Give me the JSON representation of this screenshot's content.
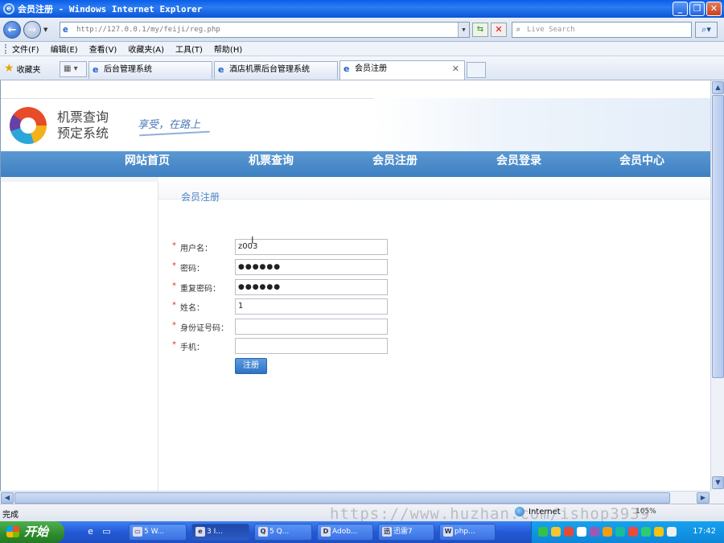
{
  "window": {
    "title": "会员注册 - Windows Internet Explorer"
  },
  "address": {
    "url": "http://127.0.0.1/my/feiji/reg.php",
    "search_placeholder": "Live Search"
  },
  "menu": [
    "文件(F)",
    "编辑(E)",
    "查看(V)",
    "收藏夹(A)",
    "工具(T)",
    "帮助(H)"
  ],
  "favorites_label": "收藏夹",
  "tabs": [
    {
      "label": "后台管理系统"
    },
    {
      "label": "酒店机票后台管理系统"
    },
    {
      "label": "会员注册"
    }
  ],
  "site": {
    "logo_line1": "机票查询",
    "logo_line2": "预定系统",
    "slogan": "享受，在路上",
    "nav": [
      "网站首页",
      "机票查询",
      "会员注册",
      "会员登录",
      "会员中心"
    ]
  },
  "form": {
    "title": "会员注册",
    "fields": [
      {
        "label": "用户名：",
        "value": "z003"
      },
      {
        "label": "密码：",
        "value": "●●●●●●"
      },
      {
        "label": "重复密码：",
        "value": "●●●●●●"
      },
      {
        "label": "姓名：",
        "value": "1"
      },
      {
        "label": "身份证号码：",
        "value": ""
      },
      {
        "label": "手机：",
        "value": ""
      }
    ],
    "required_mark": "*",
    "submit_label": "注册"
  },
  "status": {
    "text": "完成",
    "zone": "Internet",
    "zoom": "105%"
  },
  "watermark": "https://www.huzhan.com/ishop3939",
  "taskbar": {
    "start": "开始",
    "tasks": [
      "5 W...",
      "3 I...",
      "5 Q...",
      "Adob...",
      "迅雷7",
      "php..."
    ],
    "clock": "17:42"
  }
}
